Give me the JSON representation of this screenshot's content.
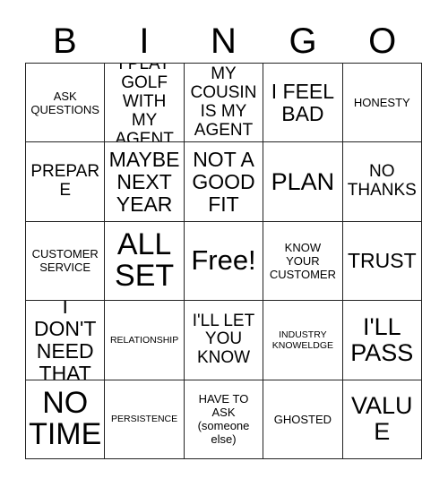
{
  "card": {
    "title": "BINGO",
    "header_letters": [
      "B",
      "I",
      "N",
      "G",
      "O"
    ],
    "border_color": "#222222",
    "background_color": "#ffffff",
    "text_color": "#000000",
    "columns": 5,
    "rows": 5,
    "free_space_label": "Free!",
    "free_space_position": "row 3, column 3"
  },
  "cells": [
    {
      "text": "ASK\nQUESTIONS",
      "size": "sm"
    },
    {
      "text": "I PLAY\nGOLF\nWITH MY\nAGENT",
      "size": "md"
    },
    {
      "text": "MY\nCOUSIN\nIS MY\nAGENT",
      "size": "md"
    },
    {
      "text": "I FEEL\nBAD",
      "size": "lg"
    },
    {
      "text": "HONESTY",
      "size": "sm"
    },
    {
      "text": "PREPARE",
      "size": "md"
    },
    {
      "text": "MAYBE\nNEXT\nYEAR",
      "size": "lg"
    },
    {
      "text": "NOT A\nGOOD\nFIT",
      "size": "lg"
    },
    {
      "text": "PLAN",
      "size": "xl"
    },
    {
      "text": "NO\nTHANKS",
      "size": "md"
    },
    {
      "text": "CUSTOMER\nSERVICE",
      "size": "sm"
    },
    {
      "text": "ALL\nSET",
      "size": "xxl"
    },
    {
      "text": "Free!",
      "size": "free"
    },
    {
      "text": "KNOW\nYOUR\nCUSTOMER",
      "size": "sm"
    },
    {
      "text": "TRUST",
      "size": "lg"
    },
    {
      "text": "I DON'T\nNEED\nTHAT",
      "size": "lg"
    },
    {
      "text": "RELATIONSHIP",
      "size": "xs"
    },
    {
      "text": "I'LL LET\nYOU\nKNOW",
      "size": "md"
    },
    {
      "text": "INDUSTRY\nKNOWELDGE",
      "size": "xs"
    },
    {
      "text": "I'LL\nPASS",
      "size": "xl"
    },
    {
      "text": "NO\nTIME",
      "size": "xxl"
    },
    {
      "text": "PERSISTENCE",
      "size": "xs"
    },
    {
      "text": "HAVE TO\nASK\n(someone\nelse)",
      "size": "sm"
    },
    {
      "text": "GHOSTED",
      "size": "sm"
    },
    {
      "text": "VALUE",
      "size": "xl"
    }
  ]
}
